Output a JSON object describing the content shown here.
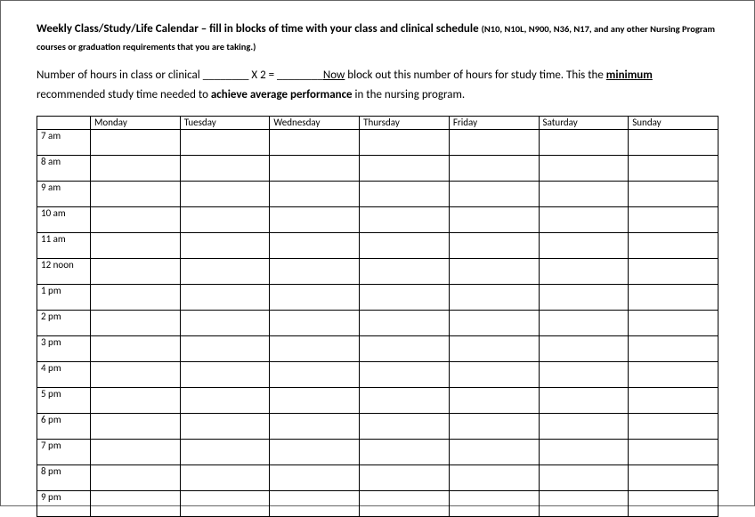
{
  "title": {
    "main": "Weekly Class/Study/Life Calendar – fill in blocks of time with your class and clinical schedule",
    "sub": "(N10, N10L, N900, N36, N17, and any other Nursing Program courses or graduation requirements that you are taking.)"
  },
  "instruction": {
    "part1": "Number of hours in class or clinical ________ X 2 = ________",
    "part2_underlined": "Now",
    "part3": " block out this number of hours for study time.   This the ",
    "part4_underlined_bold": "minimum",
    "part5": " recommended study time needed to ",
    "part6_bold": "achieve average performance",
    "part7": " in the nursing program."
  },
  "calendar": {
    "header_blank": "",
    "days": [
      "Monday",
      "Tuesday",
      "Wednesday",
      "Thursday",
      "Friday",
      "Saturday",
      "Sunday"
    ],
    "times": [
      "7 am",
      "8 am",
      "9 am",
      "10 am",
      "11 am",
      "12 noon",
      "1 pm",
      "2 pm",
      "3 pm",
      "4 pm",
      "5 pm",
      "6 pm",
      "7 pm",
      "8 pm",
      "9 pm"
    ]
  }
}
